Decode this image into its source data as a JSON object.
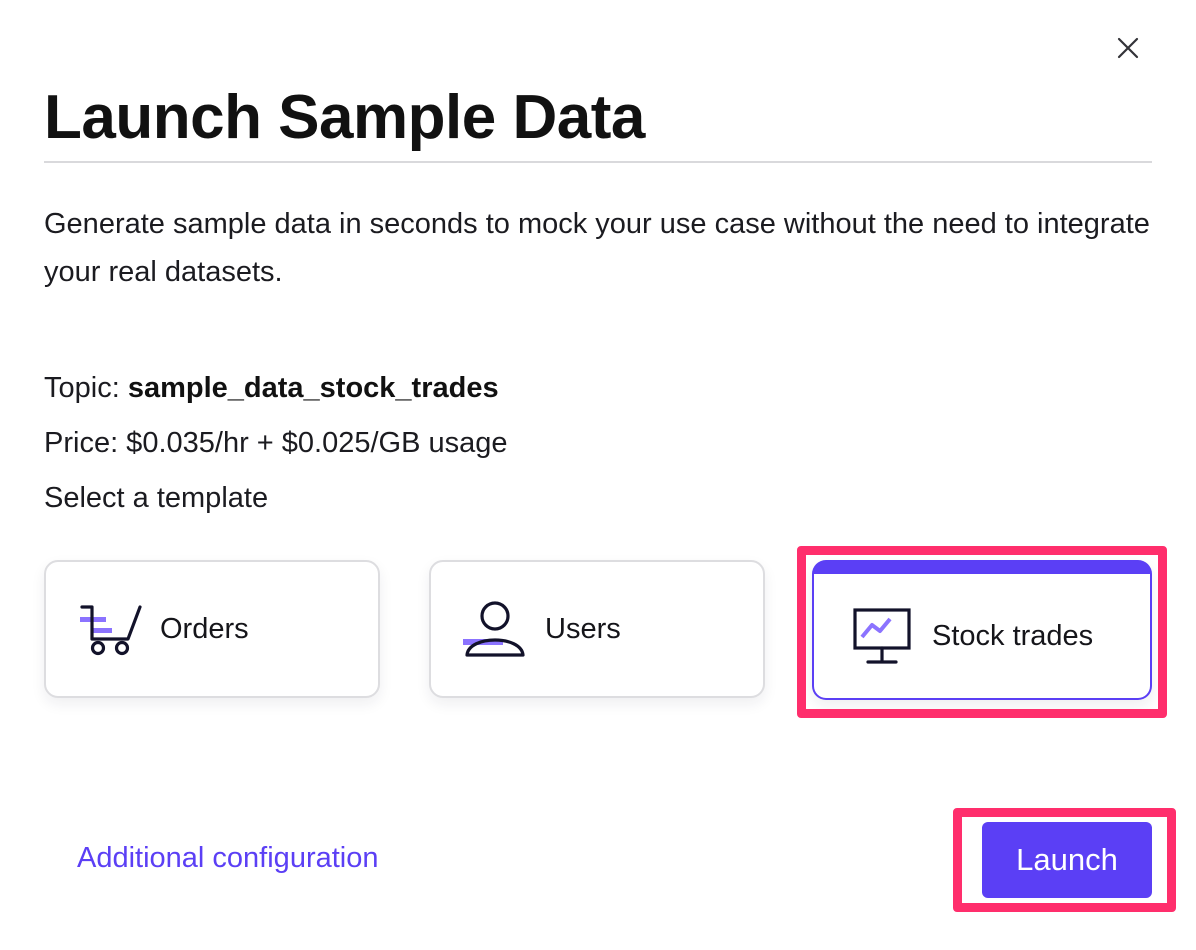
{
  "dialog": {
    "title": "Launch Sample Data",
    "description": "Generate sample data in seconds to mock your use case without the need to integrate your real datasets.",
    "close_icon": "close-icon"
  },
  "info": {
    "topic_label": "Topic:",
    "topic_value": "sample_data_stock_trades",
    "price": "Price: $0.035/hr + $0.025/GB usage",
    "select_template": "Select a template"
  },
  "templates": [
    {
      "label": "Orders",
      "icon": "shopping-cart-icon",
      "selected": false
    },
    {
      "label": "Users",
      "icon": "user-icon",
      "selected": false
    },
    {
      "label": "Stock trades",
      "icon": "chart-monitor-icon",
      "selected": true
    }
  ],
  "footer": {
    "config_link": "Additional configuration",
    "launch_label": "Launch"
  },
  "colors": {
    "accent": "#5b3ff5",
    "highlight": "#ff2e6c",
    "text": "#111111",
    "border": "#dddde0"
  }
}
